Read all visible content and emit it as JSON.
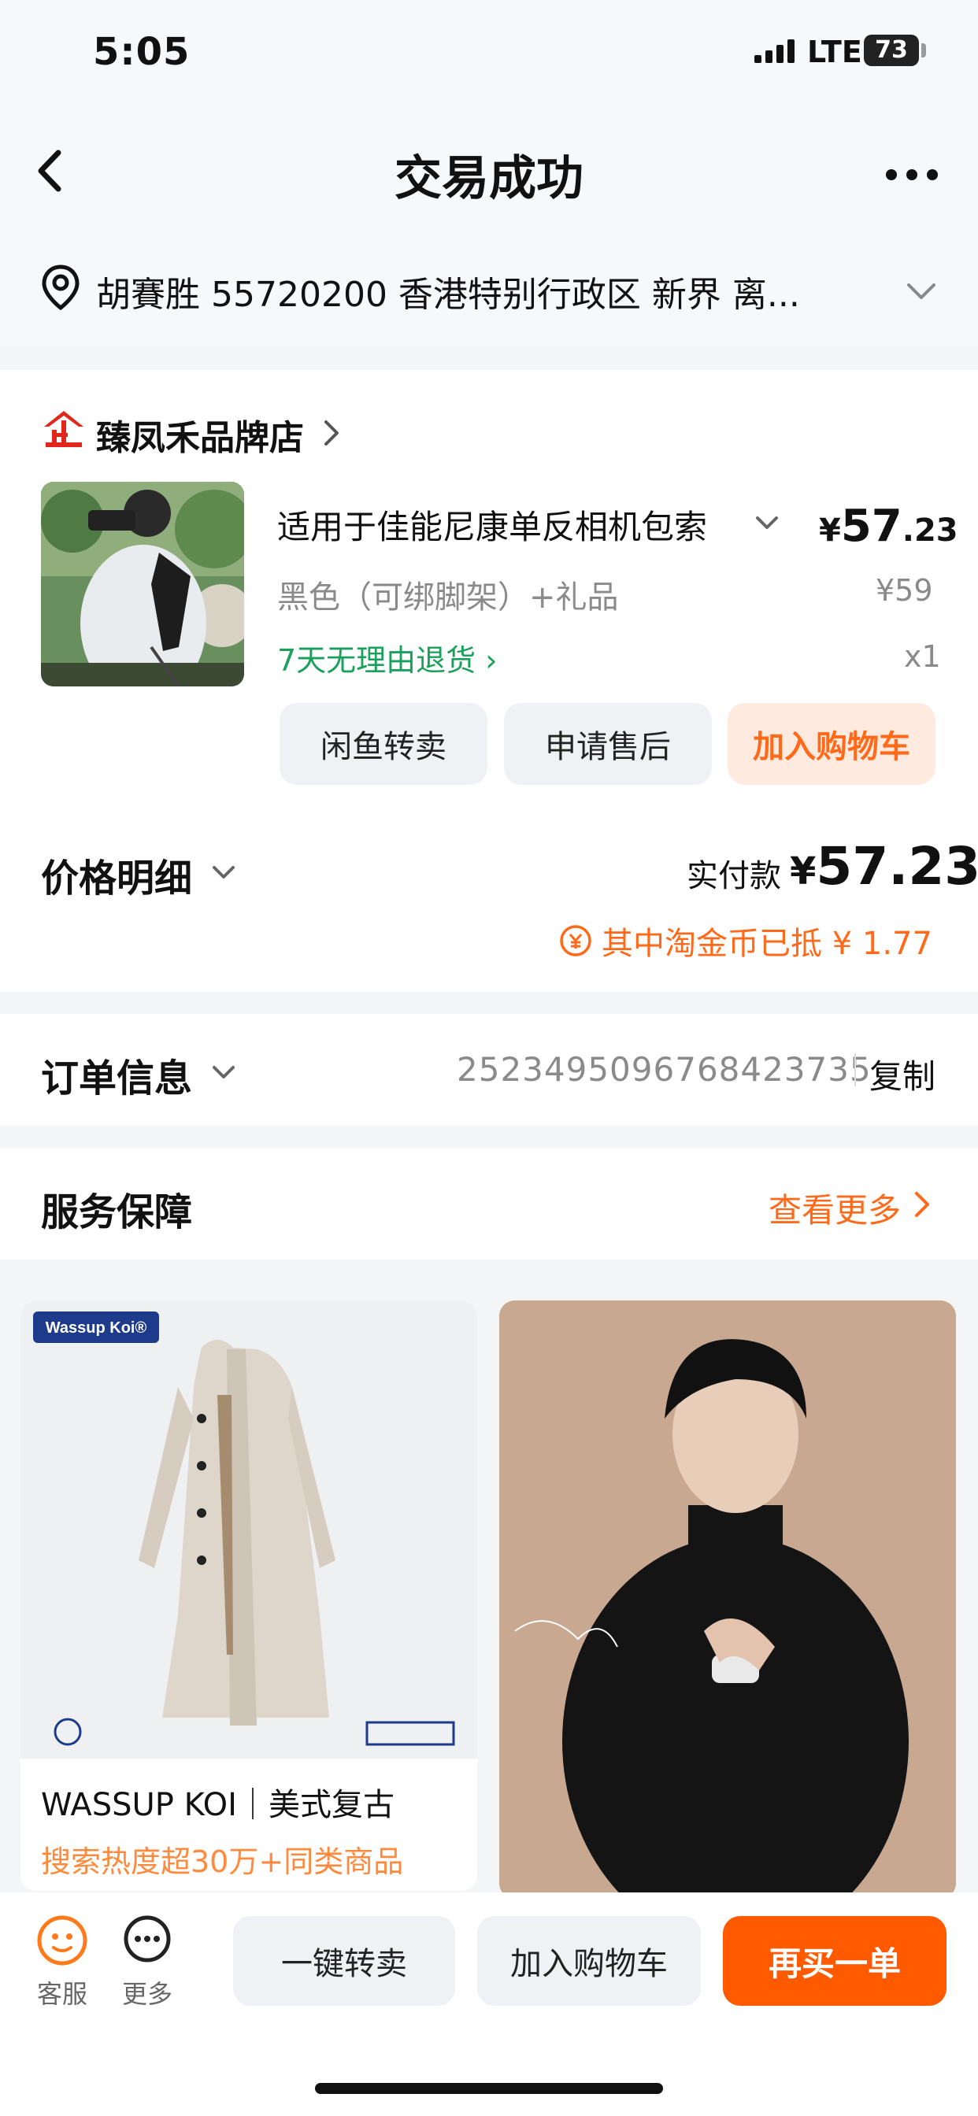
{
  "status_bar": {
    "time": "5:05",
    "network": "LTE",
    "battery": "73"
  },
  "nav": {
    "title": "交易成功"
  },
  "address": {
    "text": "胡賽胜  55720200  香港特别行政区 新界 离..."
  },
  "store": {
    "name": "臻凤禾品牌店"
  },
  "product": {
    "title": "适用于佳能尼康单反相机包索",
    "price_currency": "¥",
    "price_int": "57",
    "price_dec": ".23",
    "variant": "黑色（可绑脚架）+礼品",
    "original_price": "¥59",
    "return_policy": "7天无理由退货 ›",
    "quantity": "x1"
  },
  "order_actions": {
    "resell": "闲鱼转卖",
    "after_sale": "申请售后",
    "add_cart": "加入购物车"
  },
  "price_detail": {
    "label": "价格明细",
    "paid_label": "实付款",
    "paid_currency": "¥",
    "paid_amount": "57.23",
    "coin_note": "其中淘金币已抵 ¥ 1.77"
  },
  "order_info": {
    "label": "订单信息",
    "number": "2523495096768423735",
    "copy": "复制"
  },
  "service": {
    "label": "服务保障",
    "view_more": "查看更多"
  },
  "recommendations": [
    {
      "title": "WASSUP KOI｜美式复古",
      "subtitle": "搜索热度超30万+同类商品",
      "brand_tag": "Wassup Koi®"
    }
  ],
  "bottom_bar": {
    "customer_service": "客服",
    "more": "更多",
    "quick_resell": "一键转卖",
    "add_cart": "加入购物车",
    "buy_again": "再买一单"
  },
  "colors": {
    "accent": "#ff5a00",
    "green": "#1aa05a",
    "muted": "#8a8a8a"
  }
}
